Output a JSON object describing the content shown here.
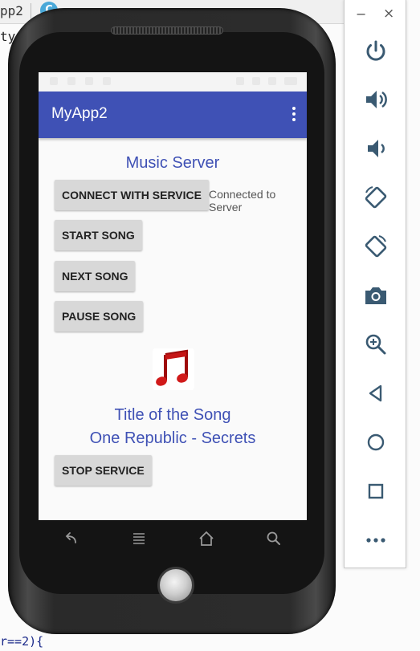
{
  "ide": {
    "tab_label": "pp2",
    "tab_icon": "C",
    "line2": "ty",
    "bottom_code": "r==2){"
  },
  "emulator_toolbar": {
    "minimize": "−",
    "close": "×",
    "buttons": [
      {
        "icon": "power-icon"
      },
      {
        "icon": "volume-up-icon"
      },
      {
        "icon": "volume-down-icon"
      },
      {
        "icon": "rotate-left-icon"
      },
      {
        "icon": "rotate-right-icon"
      },
      {
        "icon": "camera-icon"
      },
      {
        "icon": "zoom-icon"
      },
      {
        "icon": "back-icon"
      },
      {
        "icon": "home-icon"
      },
      {
        "icon": "overview-icon"
      },
      {
        "icon": "more-icon"
      }
    ]
  },
  "app": {
    "title": "MyApp2",
    "header": "Music Server",
    "connect_button": "CONNECT WITH SERVICE",
    "connection_status": "Connected to Server",
    "start_button": "START SONG",
    "next_button": "NEXT SONG",
    "pause_button": "PAUSE SONG",
    "song_title_label": "Title of the Song",
    "song_name": "One Republic - Secrets",
    "stop_button": "STOP SERVICE",
    "accent_color": "#3f51b5"
  }
}
